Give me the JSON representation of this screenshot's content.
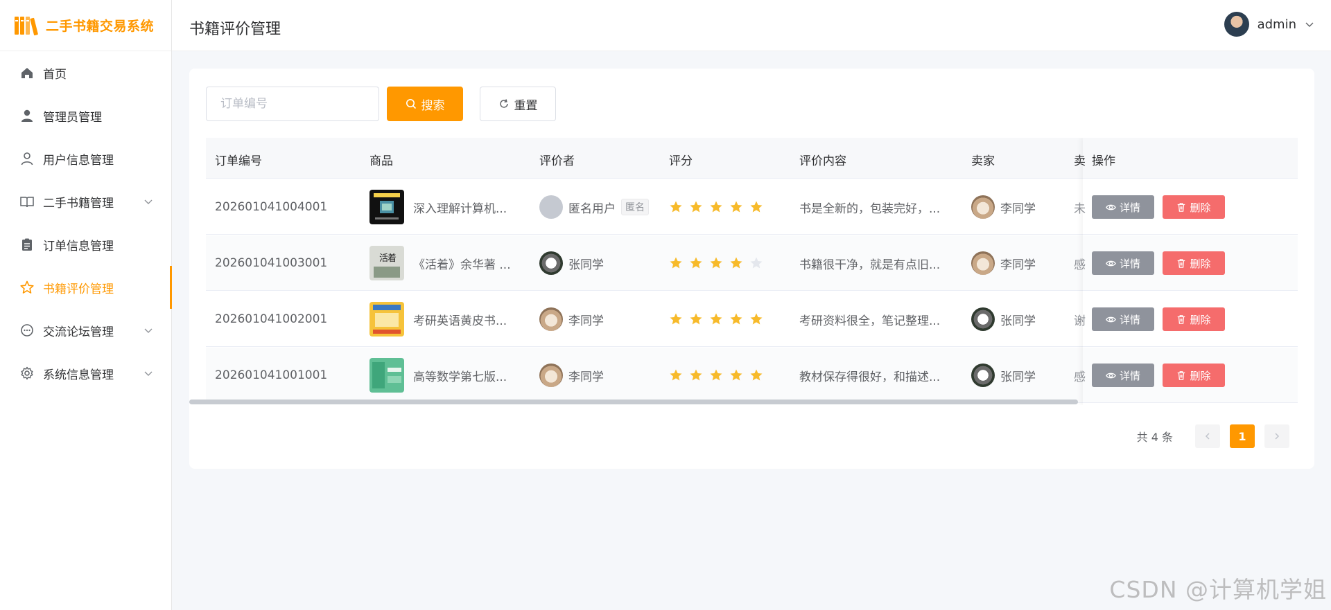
{
  "app": {
    "title": "二手书籍交易系统"
  },
  "header": {
    "page_title": "书籍评价管理",
    "username": "admin"
  },
  "sidebar": {
    "items": [
      {
        "label": "首页",
        "icon": "home-icon"
      },
      {
        "label": "管理员管理",
        "icon": "user-solid-icon"
      },
      {
        "label": "用户信息管理",
        "icon": "user-outline-icon"
      },
      {
        "label": "二手书籍管理",
        "icon": "book-icon",
        "expandable": true
      },
      {
        "label": "订单信息管理",
        "icon": "clipboard-icon"
      },
      {
        "label": "书籍评价管理",
        "icon": "star-icon",
        "active": true
      },
      {
        "label": "交流论坛管理",
        "icon": "chat-icon",
        "expandable": true
      },
      {
        "label": "系统信息管理",
        "icon": "gear-icon",
        "expandable": true
      }
    ]
  },
  "search": {
    "placeholder": "订单编号",
    "value": "",
    "search_label": "搜索",
    "reset_label": "重置"
  },
  "table": {
    "columns": [
      "订单编号",
      "商品",
      "评价者",
      "评分",
      "评价内容",
      "卖家",
      "卖",
      "操作"
    ],
    "rows": [
      {
        "order_no": "202601041004001",
        "product": "深入理解计算机...",
        "reviewer": "匿名用户",
        "reviewer_tag": "匿名",
        "reviewer_avatar": "anonymous",
        "rating": 5,
        "content": "书是全新的，包装完好，...",
        "seller": "李同学",
        "seller_avatar": "cat",
        "extra": "未"
      },
      {
        "order_no": "202601041003001",
        "product": "《活着》余华著 ...",
        "reviewer": "张同学",
        "reviewer_tag": "",
        "reviewer_avatar": "dog",
        "rating": 4,
        "content": "书籍很干净，就是有点旧...",
        "seller": "李同学",
        "seller_avatar": "cat",
        "extra": "感"
      },
      {
        "order_no": "202601041002001",
        "product": "考研英语黄皮书...",
        "reviewer": "李同学",
        "reviewer_tag": "",
        "reviewer_avatar": "cat",
        "rating": 5,
        "content": "考研资料很全，笔记整理...",
        "seller": "张同学",
        "seller_avatar": "dog",
        "extra": "谢"
      },
      {
        "order_no": "202601041001001",
        "product": "高等数学第七版...",
        "reviewer": "李同学",
        "reviewer_tag": "",
        "reviewer_avatar": "cat",
        "rating": 5,
        "content": "教材保存得很好，和描述...",
        "seller": "张同学",
        "seller_avatar": "dog",
        "extra": "感"
      }
    ],
    "detail_label": "详情",
    "delete_label": "删除",
    "rating_max": 5
  },
  "pagination": {
    "total_text": "共 4 条",
    "current_page": "1"
  },
  "watermark": "CSDN @计算机学姐",
  "colors": {
    "accent": "#ff9800",
    "danger": "#f56c6c",
    "star": "#f7ba2a",
    "star_empty": "#e4e7ed"
  }
}
